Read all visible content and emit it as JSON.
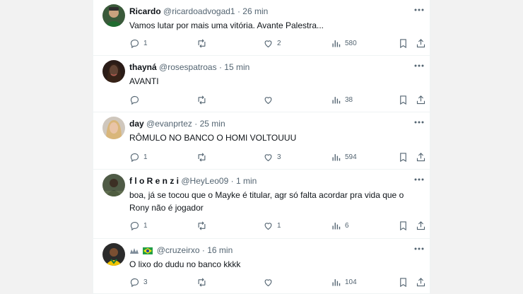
{
  "tweets": [
    {
      "name": "Ricardo",
      "handle": "@ricardoadvogad1",
      "time": "26 min",
      "text": "Vamos lutar por mais uma vitória. Avante Palestra...",
      "replies": "1",
      "retweets": "",
      "likes": "2",
      "views": "580"
    },
    {
      "name": "thayná",
      "handle": "@rosespatroas",
      "time": "15 min",
      "text": "AVANTI",
      "replies": "",
      "retweets": "",
      "likes": "",
      "views": "38"
    },
    {
      "name": "day",
      "handle": "@evanprtez",
      "time": "25 min",
      "text": "RÔMULO NO BANCO O HOMI VOLTOUUU",
      "replies": "1",
      "retweets": "",
      "likes": "3",
      "views": "594"
    },
    {
      "name": "f l o R e n z i",
      "handle": "@HeyLeo09",
      "time": "1 min",
      "text": "boa, já se tocou que o Mayke é titular, agr só falta acordar pra vida que o Rony não é jogador",
      "replies": "1",
      "retweets": "",
      "likes": "1",
      "views": "6"
    },
    {
      "name": "",
      "handle": "@cruzeirxo",
      "time": "16 min",
      "text": "O lixo do dudu no banco kkkk",
      "replies": "3",
      "retweets": "",
      "likes": "",
      "views": "104"
    }
  ],
  "separator": "·",
  "icons": [
    "more-icon",
    "reply-icon",
    "retweet-icon",
    "like-icon",
    "views-icon",
    "bookmark-icon",
    "share-icon"
  ],
  "colors": {
    "text": "#0f1419",
    "secondary": "#536471",
    "border": "#eff3f4",
    "background": "#f2f2f2"
  }
}
